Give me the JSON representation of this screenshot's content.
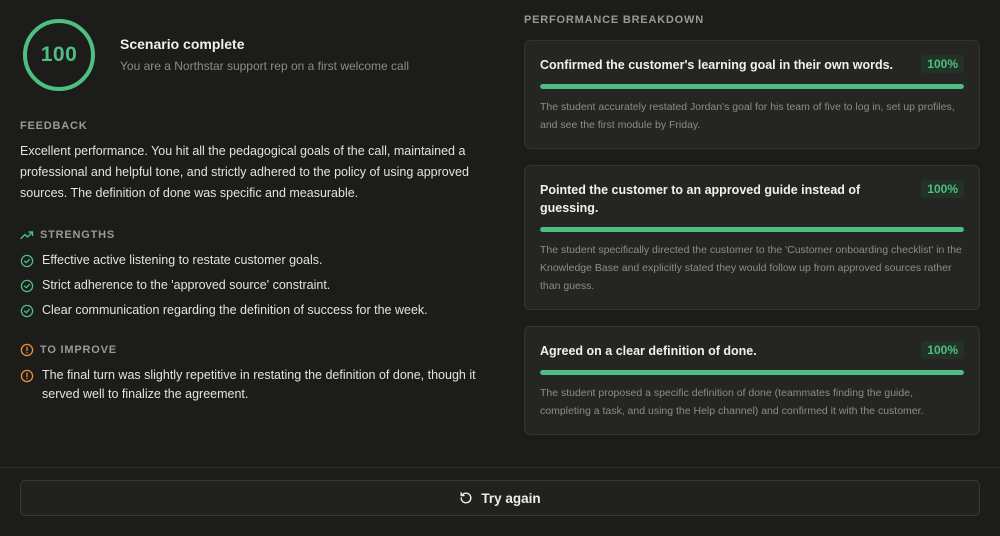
{
  "score": {
    "value": "100",
    "fraction": 1.0,
    "ring_color": "#4fbe82",
    "title": "Scenario complete",
    "subtitle": "You are a Northstar support rep on a first welcome call"
  },
  "feedback": {
    "label": "FEEDBACK",
    "text": "Excellent performance. You hit all the pedagogical goals of the call, maintained a professional and helpful tone, and strictly adhered to the policy of using approved sources. The definition of done was specific and measurable."
  },
  "strengths": {
    "label": "STRENGTHS",
    "icon": "trending-up-icon",
    "items": [
      "Effective active listening to restate customer goals.",
      "Strict adherence to the 'approved source' constraint.",
      "Clear communication regarding the definition of success for the week."
    ]
  },
  "improve": {
    "label": "TO IMPROVE",
    "icon": "alert-circle-icon",
    "items": [
      "The final turn was slightly repetitive in restating the definition of done, though it served well to finalize the agreement."
    ]
  },
  "breakdown": {
    "label": "PERFORMANCE BREAKDOWN",
    "accent": "#4fbe82",
    "cards": [
      {
        "title": "Confirmed the customer's learning goal in their own words.",
        "pct": "100%",
        "progress": 1.0,
        "desc": "The student accurately restated Jordan's goal for his team of five to log in, set up profiles, and see the first module by Friday."
      },
      {
        "title": "Pointed the customer to an approved guide instead of guessing.",
        "pct": "100%",
        "progress": 1.0,
        "desc": "The student specifically directed the customer to the 'Customer onboarding checklist' in the Knowledge Base and explicitly stated they would follow up from approved sources rather than guess."
      },
      {
        "title": "Agreed on a clear definition of done.",
        "pct": "100%",
        "progress": 1.0,
        "desc": "The student proposed a specific definition of done (teammates finding the guide, completing a task, and using the Help channel) and confirmed it with the customer."
      }
    ]
  },
  "footer": {
    "try_again_label": "Try again",
    "icon": "rotate-ccw-icon"
  }
}
